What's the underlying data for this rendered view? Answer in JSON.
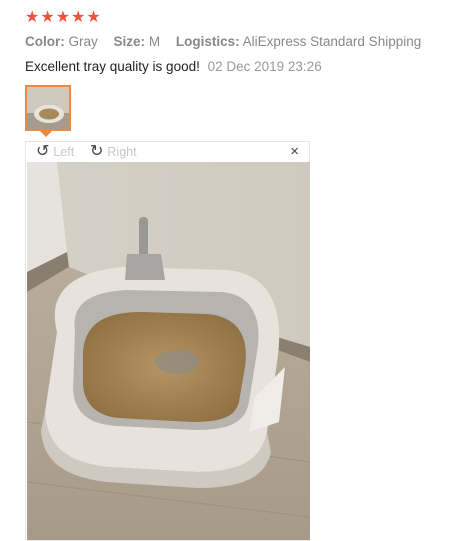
{
  "rating": {
    "stars": 5
  },
  "attributes": {
    "color_label": "Color:",
    "color_value": "Gray",
    "size_label": "Size:",
    "size_value": "M",
    "logistics_label": "Logistics:",
    "logistics_value": "AliExpress Standard Shipping"
  },
  "review": {
    "text": "Excellent tray quality is good!",
    "date": "02 Dec 2019 23:26"
  },
  "viewer": {
    "rotate_left_label": "Left",
    "rotate_right_label": "Right",
    "close_glyph": "×"
  },
  "colors": {
    "star": "#f2513b",
    "thumb_border": "#f0883e"
  },
  "icons": {
    "rotate_left": "rotate-left-icon",
    "rotate_right": "rotate-right-icon",
    "close": "close-icon"
  }
}
